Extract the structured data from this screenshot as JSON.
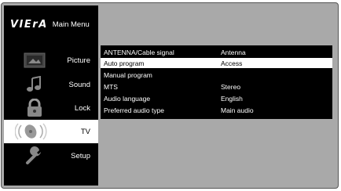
{
  "header": {
    "brand": "VIErA",
    "title": "Main Menu"
  },
  "sidebar": {
    "items": [
      {
        "label": "Picture",
        "icon": "picture-icon",
        "active": false
      },
      {
        "label": "Sound",
        "icon": "music-note-icon",
        "active": false
      },
      {
        "label": "Lock",
        "icon": "padlock-icon",
        "active": false
      },
      {
        "label": "TV",
        "icon": "satellite-dish-icon",
        "active": true
      },
      {
        "label": "Setup",
        "icon": "wrench-icon",
        "active": false
      }
    ]
  },
  "menu": {
    "rows": [
      {
        "name": "ANTENNA/Cable signal",
        "value": "Antenna",
        "selected": false
      },
      {
        "name": "Auto program",
        "value": "Access",
        "selected": true
      },
      {
        "name": "Manual program",
        "value": "",
        "selected": false
      },
      {
        "name": "MTS",
        "value": "Stereo",
        "selected": false
      },
      {
        "name": "Audio language",
        "value": "English",
        "selected": false
      },
      {
        "name": "Preferred audio type",
        "value": "Main audio",
        "selected": false
      }
    ]
  },
  "colors": {
    "background": "#a9a9a9",
    "sidebar": "#000000",
    "selected_row": "#ffffff"
  }
}
